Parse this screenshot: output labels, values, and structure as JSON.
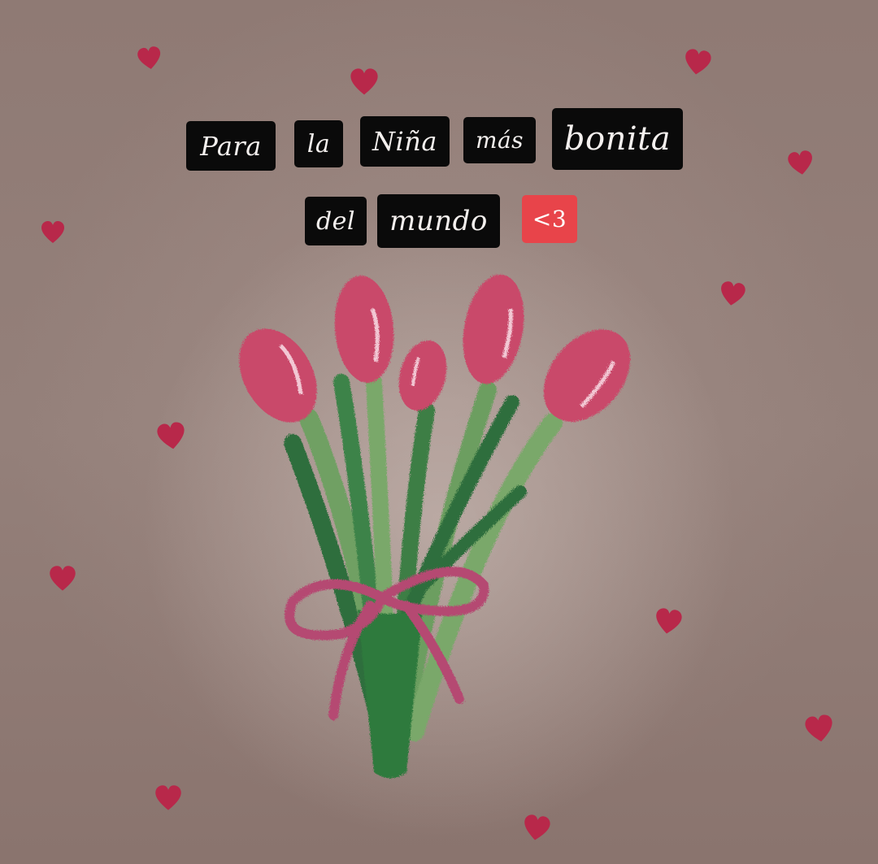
{
  "message": {
    "words": [
      "Para",
      "la",
      "Niña",
      "más",
      "bonita",
      "del",
      "mundo"
    ],
    "emoticon": "<3"
  },
  "illustration": {
    "subject": "tulip-bouquet",
    "flower_color": "#c9486a",
    "stem_color": "#3d7a45",
    "ribbon_color": "#b94a72",
    "heart_color": "#b8284a"
  }
}
